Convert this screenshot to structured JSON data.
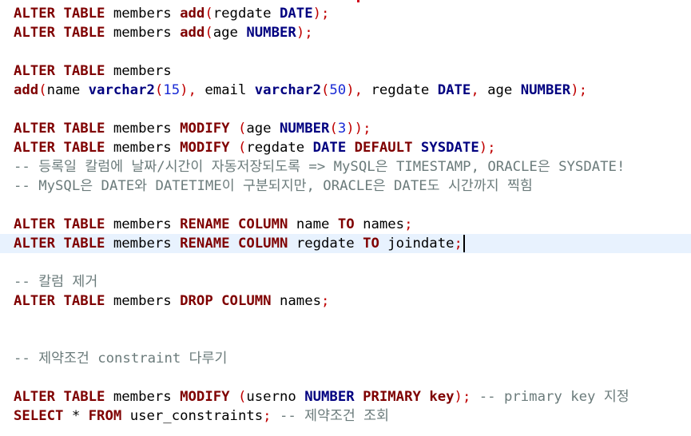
{
  "editor": {
    "language": "SQL",
    "lines": [
      {
        "text": "ALTER TABLE members add(regdate DATE);"
      },
      {
        "text": "ALTER TABLE members add(age NUMBER);"
      },
      {
        "text": ""
      },
      {
        "text": "ALTER TABLE members"
      },
      {
        "text": "add(name varchar2(15), email varchar2(50), regdate DATE, age NUMBER);"
      },
      {
        "text": ""
      },
      {
        "text": "ALTER TABLE members MODIFY (age NUMBER(3));"
      },
      {
        "text": "ALTER TABLE members MODIFY (regdate DATE DEFAULT SYSDATE);"
      },
      {
        "text": "-- 등록일 칼럼에 날짜/시간이 자동저장되도록 => MySQL은 TIMESTAMP, ORACLE은 SYSDATE!"
      },
      {
        "text": "-- MySQL은 DATE와 DATETIME이 구분되지만, ORACLE은 DATE도 시간까지 찍힘"
      },
      {
        "text": ""
      },
      {
        "text": "ALTER TABLE members RENAME COLUMN name TO names;"
      },
      {
        "text": "ALTER TABLE members RENAME COLUMN regdate TO joindate;"
      },
      {
        "text": ""
      },
      {
        "text": "-- 칼럼 제거"
      },
      {
        "text": "ALTER TABLE members DROP COLUMN names;"
      },
      {
        "text": ""
      },
      {
        "text": ""
      },
      {
        "text": "-- 제약조건 constraint 다루기"
      },
      {
        "text": ""
      },
      {
        "text": "ALTER TABLE members MODIFY (userno NUMBER PRIMARY key); -- primary key 지정"
      },
      {
        "text": "SELECT * FROM user_constraints; -- 제약조건 조회"
      }
    ],
    "current_line": 12
  },
  "colors": {
    "keyword": "#7f0000",
    "type": "#000080",
    "number": "#1a2bd6",
    "punctuation": "#bf0000",
    "comment": "#6b7b7b",
    "current_line_bg": "#e8f2fe"
  }
}
